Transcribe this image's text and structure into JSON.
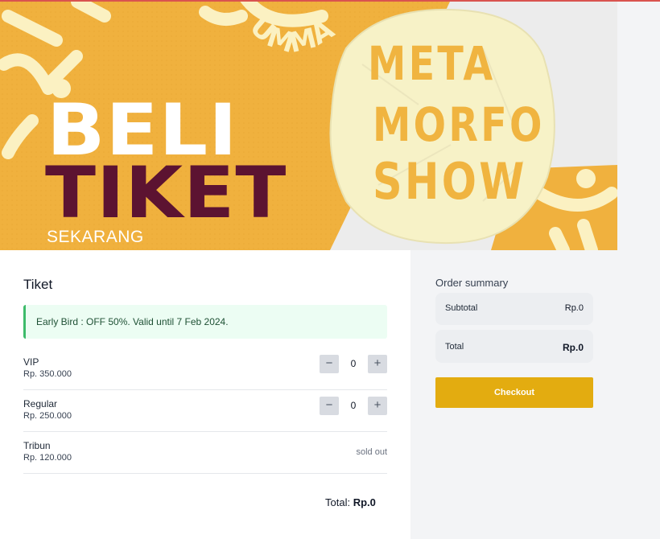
{
  "banner": {
    "headline_1": "BELI",
    "headline_2": "TIKET",
    "headline_3": "SEKARANG",
    "logo_line_1": "META",
    "logo_line_2": "MORFO",
    "logo_line_3": "SHOW",
    "arc_text": "UMMA"
  },
  "tickets": {
    "title": "Tiket",
    "promo": "Early Bird : OFF 50%. Valid until 7 Feb 2024.",
    "items": [
      {
        "name": "VIP",
        "price": "Rp. 350.000",
        "quantity": "0",
        "status": "available"
      },
      {
        "name": "Regular",
        "price": "Rp. 250.000",
        "quantity": "0",
        "status": "available"
      },
      {
        "name": "Tribun",
        "price": "Rp. 120.000",
        "status_label": "sold out"
      }
    ],
    "total_label": "Total:",
    "total_value": "Rp.0"
  },
  "stepper": {
    "minus": "−",
    "plus": "+"
  },
  "summary": {
    "title": "Order summary",
    "subtotal_label": "Subtotal",
    "subtotal_value": "Rp.0",
    "total_label": "Total",
    "total_value": "Rp.0",
    "checkout_label": "Checkout"
  },
  "colors": {
    "accent": "#e3ac10",
    "banner_orange": "#f0b13e",
    "headline_dark": "#5c1331",
    "promo_border": "#3dbb6a"
  }
}
